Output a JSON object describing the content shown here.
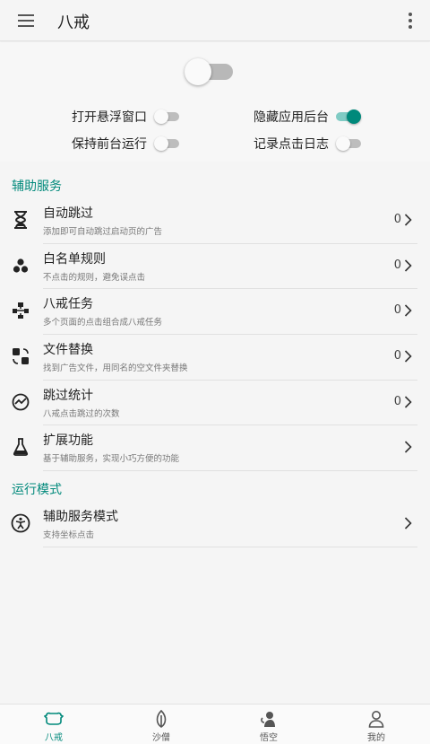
{
  "appbar": {
    "title": "八戒",
    "menu_icon": "menu-icon",
    "more_icon": "more-vert-icon"
  },
  "switches": {
    "master": {
      "on": false
    },
    "floating_window": {
      "label": "打开悬浮窗口",
      "on": false
    },
    "hide_from_recents": {
      "label": "隐藏应用后台",
      "on": true
    },
    "keep_foreground": {
      "label": "保持前台运行",
      "on": false
    },
    "log_clicks": {
      "label": "记录点击日志",
      "on": false
    }
  },
  "sections": {
    "accessibility": {
      "title": "辅助服务",
      "items": [
        {
          "title": "自动跳过",
          "subtitle": "添加即可自动跳过启动页的广告",
          "count": "0",
          "icon": "hourglass-icon"
        },
        {
          "title": "白名单规则",
          "subtitle": "不点击的规则，避免误点击",
          "count": "0",
          "icon": "dots-cluster-icon"
        },
        {
          "title": "八戒任务",
          "subtitle": "多个页面的点击组合成八戒任务",
          "count": "0",
          "icon": "workflow-icon"
        },
        {
          "title": "文件替换",
          "subtitle": "找到广告文件，用同名的空文件夹替换",
          "count": "0",
          "icon": "swap-icon"
        },
        {
          "title": "跳过统计",
          "subtitle": "八戒点击跳过的次数",
          "count": "0",
          "icon": "stats-icon"
        },
        {
          "title": "扩展功能",
          "subtitle": "基于辅助服务，实现小巧方便的功能",
          "count": "",
          "icon": "flask-icon"
        }
      ]
    },
    "run_mode": {
      "title": "运行模式",
      "items": [
        {
          "title": "辅助服务模式",
          "subtitle": "支持坐标点击",
          "count": "",
          "icon": "accessibility-icon"
        }
      ]
    }
  },
  "bottom_nav": [
    {
      "label": "八戒",
      "icon": "pig-icon",
      "active": true
    },
    {
      "label": "沙僧",
      "icon": "leaf-icon",
      "active": false
    },
    {
      "label": "悟空",
      "icon": "monkey-icon",
      "active": false
    },
    {
      "label": "我的",
      "icon": "person-icon",
      "active": false
    }
  ],
  "colors": {
    "accent": "#00897b",
    "accent_light": "#80cbc4",
    "background": "#f5f5f5"
  }
}
